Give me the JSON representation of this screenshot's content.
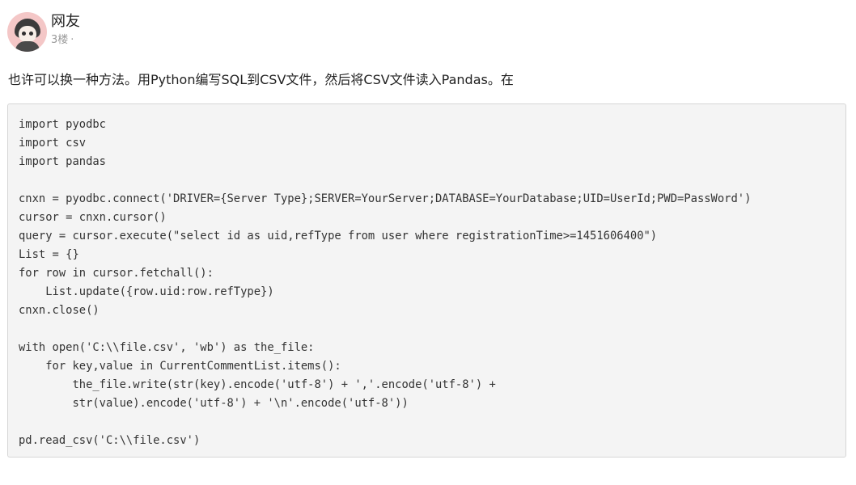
{
  "post": {
    "username": "网友",
    "floor": "3楼",
    "floor_separator": "·",
    "text": "也许可以换一种方法。用Python编写SQL到CSV文件，然后将CSV文件读入Pandas。在",
    "code_lines": [
      "import pyodbc",
      "import csv",
      "import pandas",
      "",
      "cnxn = pyodbc.connect('DRIVER={Server Type};SERVER=YourServer;DATABASE=YourDatabase;UID=UserId;PWD=PassWord')",
      "cursor = cnxn.cursor()",
      "query = cursor.execute(\"select id as uid,refType from user where registrationTime>=1451606400\")",
      "List = {}",
      "for row in cursor.fetchall():",
      "    List.update({row.uid:row.refType})",
      "cnxn.close()",
      "",
      "with open('C:\\\\file.csv', 'wb') as the_file:",
      "    for key,value in CurrentCommentList.items():",
      "        the_file.write(str(key).encode('utf-8') + ','.encode('utf-8') +",
      "        str(value).encode('utf-8') + '\\n'.encode('utf-8'))",
      "",
      "pd.read_csv('C:\\\\file.csv')"
    ]
  }
}
